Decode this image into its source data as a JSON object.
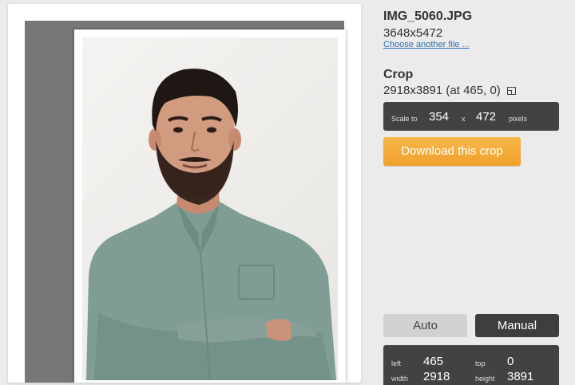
{
  "file": {
    "name": "IMG_5060.JPG",
    "dimensions": "3648x5472",
    "change_link": "Choose another file ..."
  },
  "crop": {
    "heading": "Crop",
    "info": "2918x3891 (at 465, 0)",
    "info_icon": "resize-icon"
  },
  "scale": {
    "label": "Scale to",
    "width": "354",
    "x": "x",
    "height": "472",
    "unit": "pixels"
  },
  "download_label": "Download this crop",
  "modes": {
    "auto": "Auto",
    "manual": "Manual",
    "selected": "Manual"
  },
  "coords": {
    "left_label": "left",
    "left": "465",
    "top_label": "top",
    "top": "0",
    "width_label": "width",
    "width": "2918",
    "height_label": "height",
    "height": "3891"
  },
  "colors": {
    "accent": "#f0a02a",
    "dark_box": "#424242",
    "link": "#2f6fb4",
    "shirt": "#7f9d95"
  }
}
